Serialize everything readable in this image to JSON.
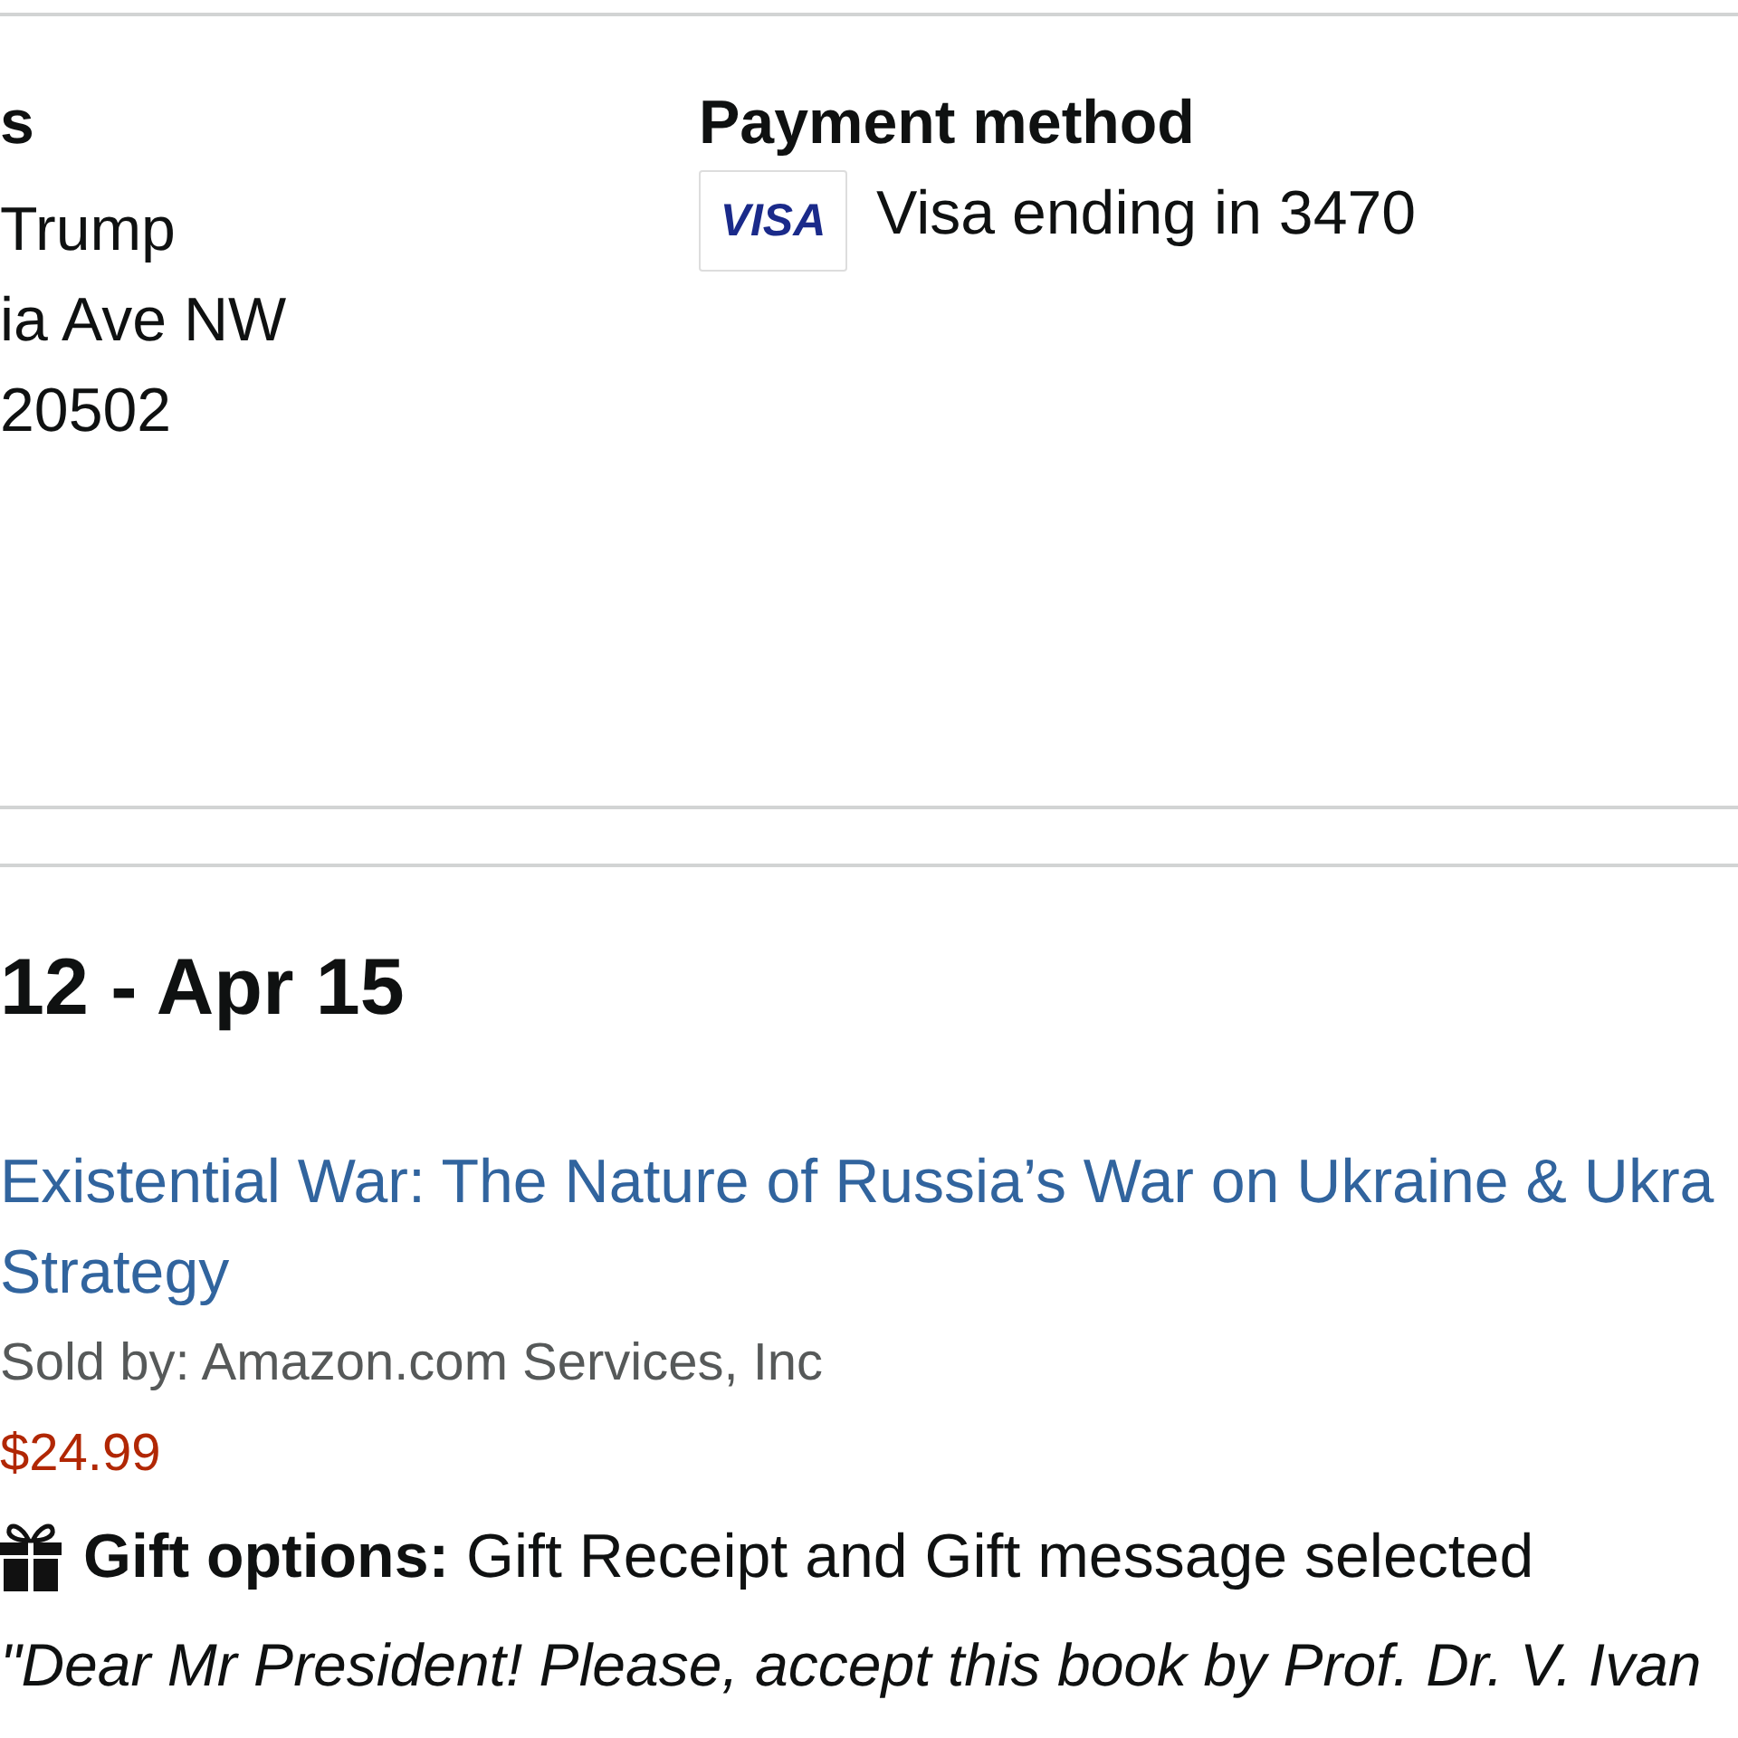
{
  "shipping_address": {
    "heading": "s",
    "lines": [
      "Trump",
      "ia Ave NW",
      "20502"
    ]
  },
  "payment_method": {
    "heading": "Payment method",
    "card_logo": "VISA",
    "card_description": "Visa ending in 3470"
  },
  "shipment": {
    "delivery_date": "12 - Apr 15",
    "items": [
      {
        "title_lines": [
          "Existential War: The Nature of Russia’s War on Ukraine & Ukra",
          "Strategy"
        ],
        "sold_by": "Sold by: Amazon.com Services, Inc",
        "price": "$24.99",
        "gift_options": "**Gift options:** Gift Receipt and Gift message selected",
        "gift_message": "\"Dear Mr President! Please, accept this book by Prof. Dr. V. Ivan"
      }
    ]
  }
}
